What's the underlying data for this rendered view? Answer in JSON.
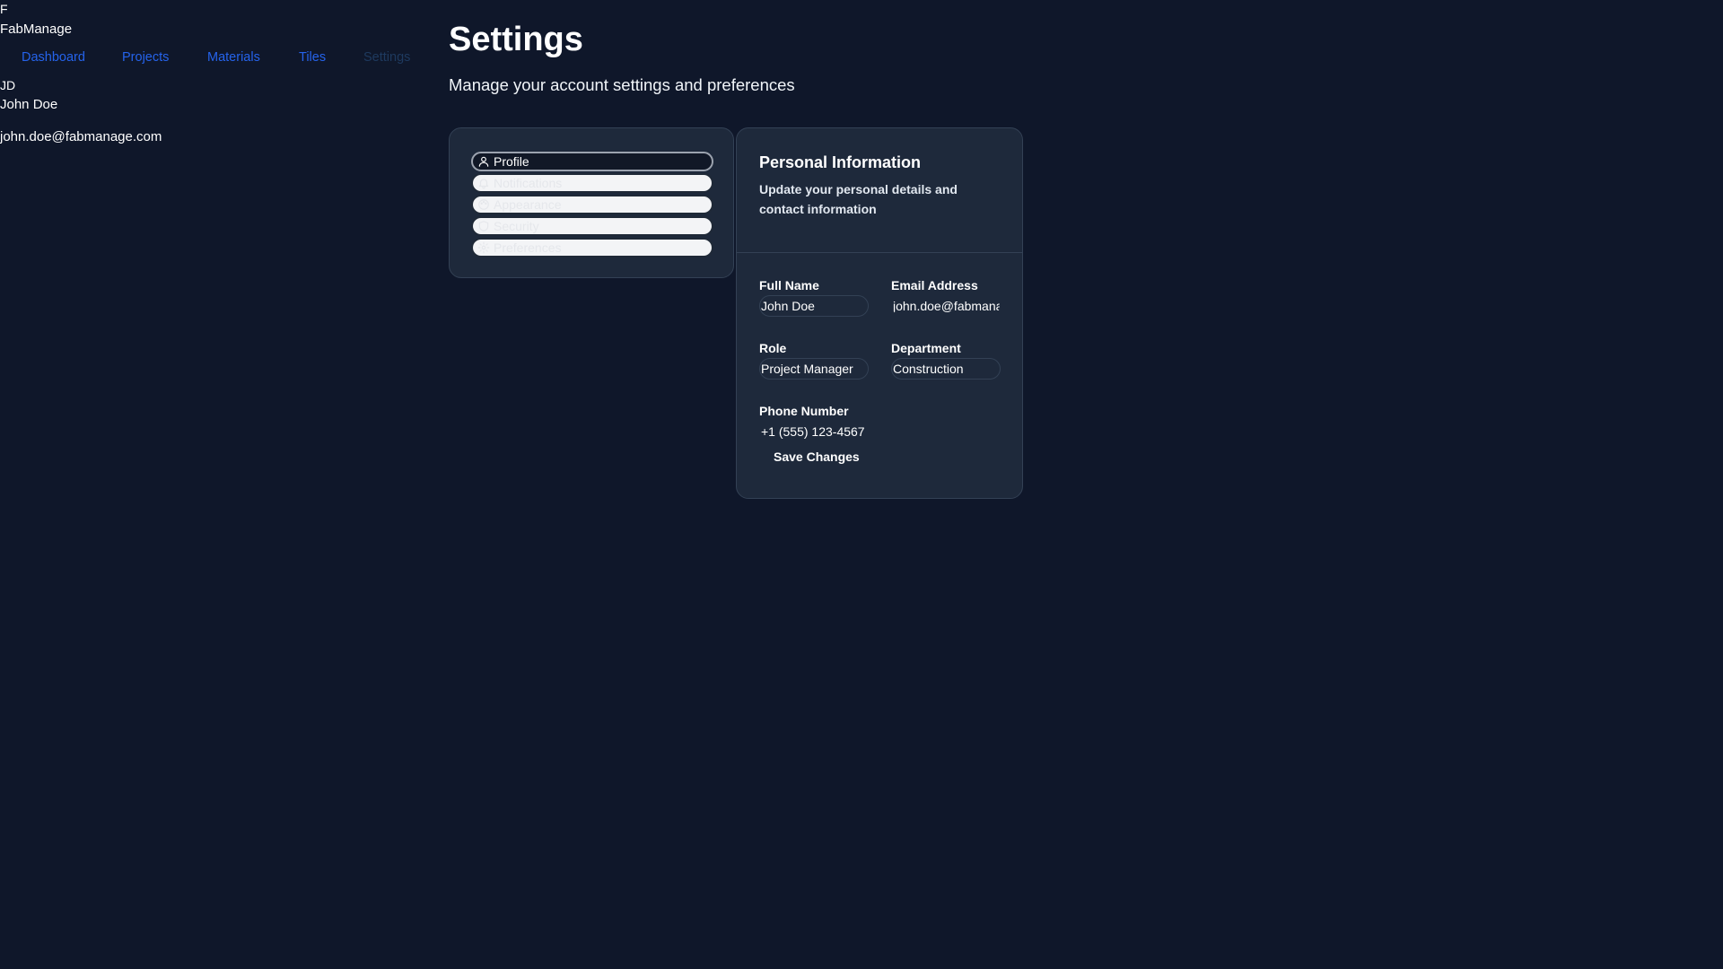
{
  "app": {
    "logo_letter": "F",
    "name": "FabManage"
  },
  "nav": {
    "items": [
      {
        "label": "Dashboard"
      },
      {
        "label": "Projects"
      },
      {
        "label": "Materials"
      },
      {
        "label": "Tiles"
      },
      {
        "label": "Settings"
      }
    ],
    "active": "Settings"
  },
  "user": {
    "initials": "JD",
    "name": "John Doe",
    "email": "john.doe@fabmanage.com"
  },
  "page": {
    "title": "Settings",
    "subtitle": "Manage your account settings and preferences"
  },
  "settings_tabs": [
    {
      "label": "Profile",
      "icon": "user-icon",
      "active": true
    },
    {
      "label": "Notifications",
      "icon": "bell-icon",
      "active": false
    },
    {
      "label": "Appearance",
      "icon": "palette-icon",
      "active": false
    },
    {
      "label": "Security",
      "icon": "shield-icon",
      "active": false
    },
    {
      "label": "Preferences",
      "icon": "gear-icon",
      "active": false
    }
  ],
  "personal_info": {
    "title": "Personal Information",
    "description": "Update your personal details and contact information",
    "fields": {
      "full_name": {
        "label": "Full Name",
        "value": "John Doe"
      },
      "email": {
        "label": "Email Address",
        "value": "john.doe@fabmanage.com"
      },
      "role": {
        "label": "Role",
        "value": "Project Manager"
      },
      "department": {
        "label": "Department",
        "value": "Construction"
      },
      "phone": {
        "label": "Phone Number",
        "value": "+1 (555) 123-4567"
      }
    },
    "save_label": "Save Changes"
  },
  "colors": {
    "background": "#0f172a",
    "card": "#1e293b",
    "card_border": "#334155",
    "nav_link": "#2563eb",
    "nav_active": "#1e3a5f"
  }
}
